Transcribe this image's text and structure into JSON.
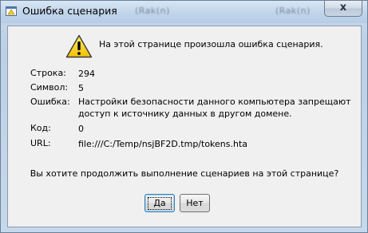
{
  "window": {
    "title": "Ошибка сценария",
    "ghost_labels": [
      "(Rak(n)",
      "(Rak(n)"
    ],
    "close_symbol": "x"
  },
  "dialog": {
    "headline": "На этой странице произошла ошибка сценария.",
    "line_label": "Строка:",
    "line_value": "294",
    "char_label": "Символ:",
    "char_value": "5",
    "error_label": "Ошибка:",
    "error_line1": "Настройки безопасности данного компьютера запрещают",
    "error_line2": "доступ к источнику данных в другом домене.",
    "code_label": "Код:",
    "code_value": "0",
    "url_label": "URL:",
    "url_value": "file:///C:/Temp/nsjBF2D.tmp/tokens.hta",
    "question": "Вы хотите продолжить выполнение сценариев на этой странице?"
  },
  "buttons": {
    "yes_label": "Да",
    "no_label": "Нет"
  },
  "colors": {
    "title_bar": "#bfd3e9",
    "content_bg": "#f0f0f0",
    "warning_yellow": "#f7d41c",
    "default_button_border": "#3c7fb1"
  },
  "icons": {
    "title": "script-error-icon",
    "warning": "warning-icon"
  }
}
